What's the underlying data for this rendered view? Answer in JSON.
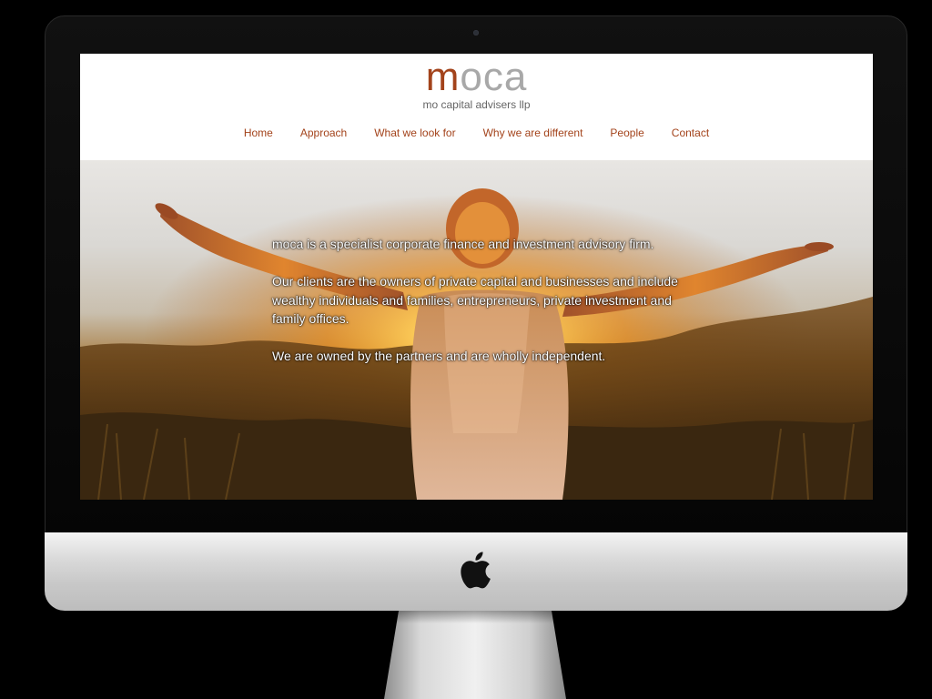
{
  "brand": {
    "logo_first": "m",
    "logo_rest": "oca",
    "tagline": "mo capital advisers llp",
    "accent_color": "#a3431b"
  },
  "nav": {
    "items": [
      {
        "label": "Home"
      },
      {
        "label": "Approach"
      },
      {
        "label": "What we look for"
      },
      {
        "label": "Why we are different"
      },
      {
        "label": "People"
      },
      {
        "label": "Contact"
      }
    ]
  },
  "hero": {
    "paragraphs": [
      "moca is a specialist corporate finance and investment advisory firm.",
      "Our clients are the owners of private capital and businesses and include wealthy individuals and families, entrepreneurs, private investment and family offices.",
      "We are owned by the partners and are wholly independent."
    ]
  },
  "device": {
    "icons": [
      "apple-icon",
      "camera-icon"
    ]
  }
}
